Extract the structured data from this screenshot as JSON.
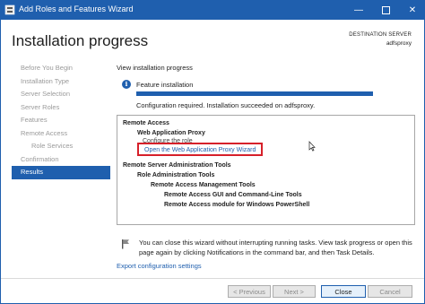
{
  "window": {
    "title": "Add Roles and Features Wizard",
    "minimize_glyph": "—",
    "close_glyph": "✕"
  },
  "header": {
    "page_title": "Installation progress",
    "destination_label": "DESTINATION SERVER",
    "destination_value": "adfsproxy"
  },
  "nav": {
    "items": [
      {
        "label": "Before You Begin",
        "state": "disabled"
      },
      {
        "label": "Installation Type",
        "state": "disabled"
      },
      {
        "label": "Server Selection",
        "state": "disabled"
      },
      {
        "label": "Server Roles",
        "state": "disabled"
      },
      {
        "label": "Features",
        "state": "disabled"
      },
      {
        "label": "Remote Access",
        "state": "disabled"
      },
      {
        "label": "Role Services",
        "state": "disabled"
      },
      {
        "label": "Confirmation",
        "state": "disabled"
      },
      {
        "label": "Results",
        "state": "active"
      }
    ]
  },
  "main": {
    "section_heading": "View installation progress",
    "info_icon_glyph": "i",
    "progress": {
      "title": "Feature installation",
      "fraction": 1.0,
      "status": "Configuration required. Installation succeeded on adfsproxy."
    },
    "results": [
      {
        "text": "Remote Access",
        "level": 0,
        "style": "bold"
      },
      {
        "text": "Web Application Proxy",
        "level": 1,
        "style": "bold"
      },
      {
        "text": "Configure the role",
        "level": 2,
        "style": "muted"
      },
      {
        "text": "Open the Web Application Proxy Wizard",
        "level": 2,
        "style": "link"
      },
      {
        "text": "Remote Server Administration Tools",
        "level": 0,
        "style": "bold"
      },
      {
        "text": "Role Administration Tools",
        "level": 1,
        "style": "bold"
      },
      {
        "text": "Remote Access Management Tools",
        "level": 2,
        "style": "bold"
      },
      {
        "text": "Remote Access GUI and Command-Line Tools",
        "level": 3,
        "style": "bold"
      },
      {
        "text": "Remote Access module for Windows PowerShell",
        "level": 3,
        "style": "bold"
      }
    ],
    "notice": "You can close this wizard without interrupting running tasks. View task progress or open this page again by clicking Notifications in the command bar, and then Task Details.",
    "export_link": "Export configuration settings"
  },
  "footer": {
    "previous_label": "< Previous",
    "next_label": "Next >",
    "close_label": "Close",
    "cancel_label": "Cancel"
  },
  "colors": {
    "accent": "#1f5fae",
    "highlight": "#d6202a"
  }
}
